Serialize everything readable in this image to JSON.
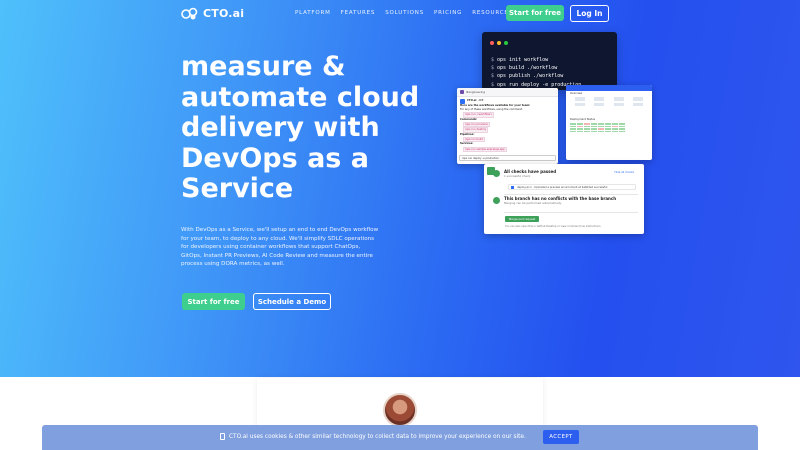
{
  "nav": {
    "logo_text": "CTO.ai",
    "links": [
      "PLATFORM",
      "FEATURES",
      "SOLUTIONS",
      "PRICING",
      "RESOURCES"
    ],
    "start_label": "Start for free",
    "login_label": "Log In"
  },
  "hero": {
    "headline": "measure & automate cloud delivery with DevOps as a Service",
    "subcopy": "With DevOps as a Service, we'll setup an end to end DevOps workflow for your team, to deploy to any cloud. We'll simplify SDLC operations for developers using container workflows that support ChatOps, GitOps, Instant PR Previews, AI Code Review and measure the entire process using DORA metrics, as well.",
    "start_label": "Start for free",
    "demo_label": "Schedule a Demo"
  },
  "terminal": {
    "prompt": "$",
    "lines": [
      "ops init workflow",
      "ops build ./workflow",
      "ops publish ./workflow",
      "ops run deploy -e production"
    ]
  },
  "chat": {
    "header": "#engineering",
    "bot_name": "CTO.ai",
    "bot_tag": "APP",
    "intro": "Here are the workflows available for your team:",
    "hint": "For any of these workflows, using the command",
    "hint_code": "/ops run <workflow>",
    "commands_label": "Commands:",
    "commands": [
      "/ops run provision",
      "/ops run destroy"
    ],
    "pipelines_label": "Pipelines:",
    "pipelines": [
      "/ops run build"
    ],
    "services_label": "Services:",
    "services": [
      "/ops run sample-expressjs-app"
    ],
    "input": "/ops run deploy -e production"
  },
  "dashboard": {
    "overview": "Overview",
    "deploy_status": "Deployment Status"
  },
  "pr": {
    "check1_title": "All checks have passed",
    "check1_sub": "1 successful check",
    "link": "Hide all checks",
    "inner": "deploy-pr-1 - Uploaded a preview environment at 4a6b3ed successful",
    "check2_title": "This branch has no conflicts with the base branch",
    "check2_sub": "Merging can be performed automatically.",
    "merge_label": "Merge pull request",
    "hint": "You can also open this in GitHub Desktop or view command line instructions."
  },
  "cookie": {
    "message": "CTO.ai uses cookies & other similar technology to collect data to improve your experience on our site.",
    "accept_label": "ACCEPT"
  },
  "colors": {
    "accent_green": "#3ecf8e",
    "brand_blue": "#2c5ff0",
    "cookie_bg": "#7f9fdf"
  }
}
